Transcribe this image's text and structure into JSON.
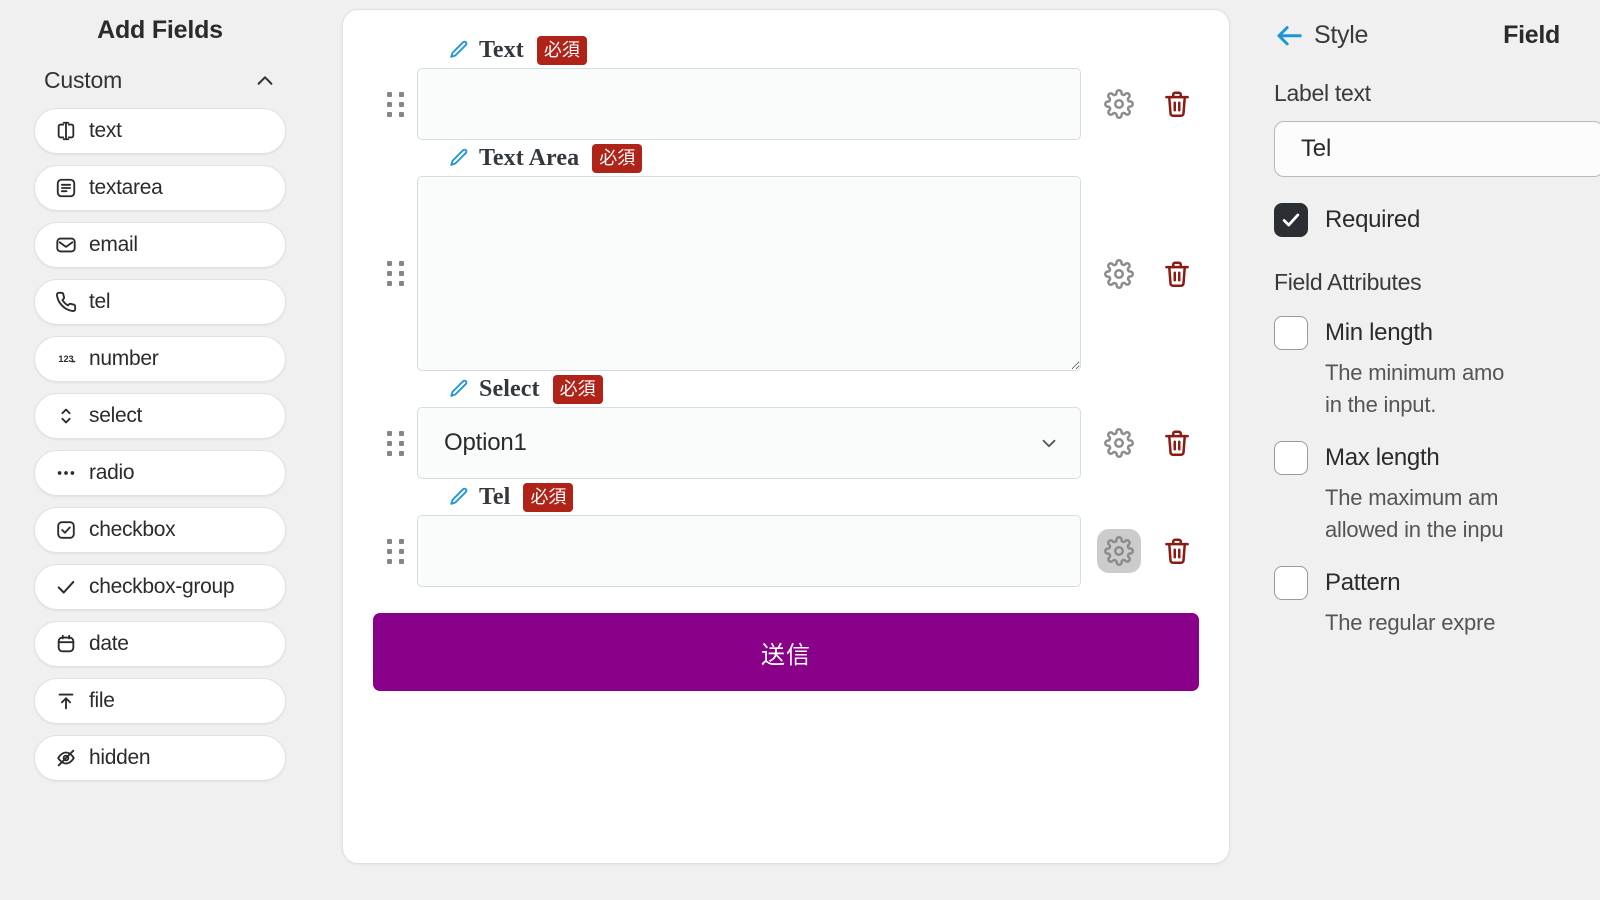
{
  "sidebar": {
    "title": "Add Fields",
    "group": {
      "label": "Custom",
      "collapse_icon": "chevron-up-icon",
      "expanded": true
    },
    "items": [
      {
        "label": "text",
        "icon": "text-cursor-icon"
      },
      {
        "label": "textarea",
        "icon": "textarea-icon"
      },
      {
        "label": "email",
        "icon": "envelope-icon"
      },
      {
        "label": "tel",
        "icon": "phone-icon"
      },
      {
        "label": "number",
        "icon": "number-123-icon"
      },
      {
        "label": "select",
        "icon": "chevron-updown-icon"
      },
      {
        "label": "radio",
        "icon": "three-dots-icon"
      },
      {
        "label": "checkbox",
        "icon": "checkbox-icon"
      },
      {
        "label": "checkbox-group",
        "icon": "check-icon"
      },
      {
        "label": "date",
        "icon": "calendar-icon"
      },
      {
        "label": "file",
        "icon": "upload-icon"
      },
      {
        "label": "hidden",
        "icon": "eye-off-icon"
      }
    ]
  },
  "form": {
    "required_badge": "必須",
    "edit_icon": "pencil-icon",
    "drag_icon": "drag-handle-icon",
    "settings_icon": "gear-icon",
    "delete_icon": "trash-icon",
    "fields": [
      {
        "legend": "Text",
        "type": "text",
        "required": true,
        "value": "",
        "settings_active": false
      },
      {
        "legend": "Text Area",
        "type": "textarea",
        "required": true,
        "value": "",
        "settings_active": false
      },
      {
        "legend": "Select",
        "type": "select",
        "required": true,
        "value": "Option1",
        "settings_active": false
      },
      {
        "legend": "Tel",
        "type": "tel",
        "required": true,
        "value": "",
        "settings_active": true
      }
    ],
    "submit_label": "送信",
    "submit_color": "#890089"
  },
  "inspector": {
    "back_label": "Style",
    "back_icon": "arrow-left-icon",
    "fields_tab_label": "Field",
    "label_text_heading": "Label text",
    "label_text_value": "Tel",
    "required": {
      "label": "Required",
      "checked": true
    },
    "attributes_heading": "Field Attributes",
    "attributes": [
      {
        "label": "Min length",
        "checked": false,
        "description_lines": [
          "The minimum amo",
          "in the input."
        ]
      },
      {
        "label": "Max length",
        "checked": false,
        "description_lines": [
          "The maximum am",
          "allowed in the inpu"
        ]
      },
      {
        "label": "Pattern",
        "checked": false,
        "description_lines": [
          "The regular expre"
        ]
      }
    ]
  },
  "colors": {
    "accent_blue": "#1c96d6",
    "badge_red": "#b02318",
    "trash_red": "#8c1a12",
    "submit_purple": "#890089",
    "page_bg": "#f0f0f0"
  }
}
